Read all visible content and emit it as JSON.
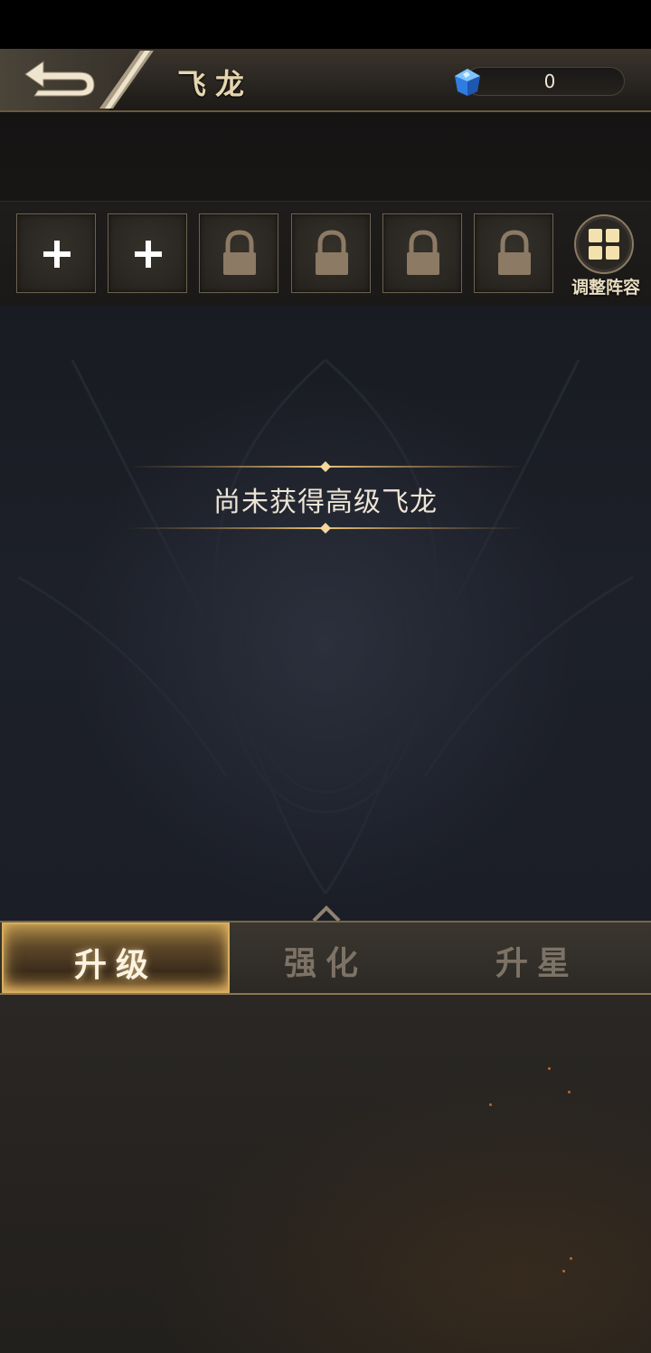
{
  "header": {
    "title": "飞龙",
    "currency": {
      "icon": "blue-gem-icon",
      "value": "0"
    }
  },
  "formation": {
    "slots": [
      {
        "state": "add",
        "icon": "plus-icon"
      },
      {
        "state": "add",
        "icon": "plus-icon"
      },
      {
        "state": "locked",
        "icon": "lock-icon"
      },
      {
        "state": "locked",
        "icon": "lock-icon"
      },
      {
        "state": "locked",
        "icon": "lock-icon"
      },
      {
        "state": "locked",
        "icon": "lock-icon"
      }
    ],
    "adjust_label": "调整阵容"
  },
  "main": {
    "notice": "尚未获得高级飞龙"
  },
  "tabs": [
    {
      "label": "升级",
      "active": true
    },
    {
      "label": "强化",
      "active": false
    },
    {
      "label": "升星",
      "active": false
    }
  ],
  "colors": {
    "accent_gold": "#d8ad5c",
    "text_light": "#ece4d6",
    "tab_inactive": "#7c7366"
  }
}
